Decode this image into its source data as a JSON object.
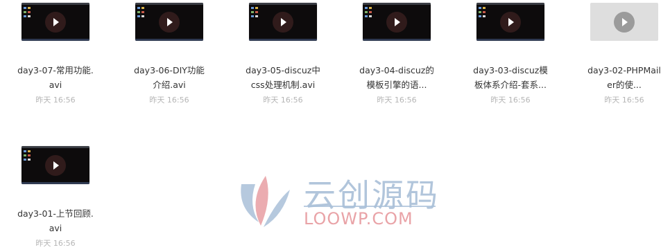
{
  "files": [
    {
      "name": "day3-07-常用功能.avi",
      "time": "昨天 16:56",
      "faded": false
    },
    {
      "name": "day3-06-DIY功能介绍.avi",
      "time": "昨天 16:56",
      "faded": false
    },
    {
      "name": "day3-05-discuz中css处理机制.avi",
      "time": "昨天 16:56",
      "faded": false
    },
    {
      "name": "day3-04-discuz的模板引擎的语...",
      "time": "昨天 16:56",
      "faded": false
    },
    {
      "name": "day3-03-discuz模板体系介绍-套系...",
      "time": "昨天 16:56",
      "faded": false
    },
    {
      "name": "day3-02-PHPMailer的使...",
      "time": "昨天 16:56",
      "faded": true
    },
    {
      "name": "day3-01-上节回顾.avi",
      "time": "昨天 16:56",
      "faded": false
    }
  ],
  "watermark": {
    "cn": "云创源码",
    "en": "LOOWP.COM",
    "colors": {
      "blue": "#a9bfd8",
      "pink": "#e9a3a7"
    }
  }
}
